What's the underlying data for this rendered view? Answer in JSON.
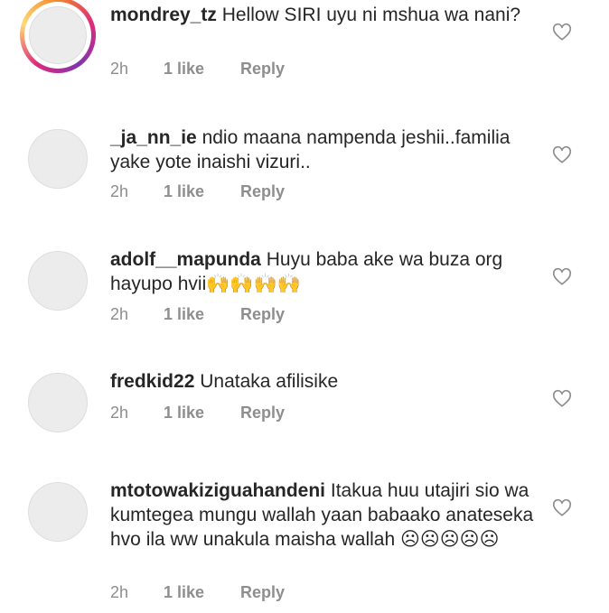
{
  "comments": [
    {
      "username": "mondrey_tz",
      "text": "Hellow SIRI  uyu ni mshua wa nani?",
      "time": "2h",
      "likes": "1 like",
      "reply": "Reply",
      "has_story": true,
      "avatar_icon": "avatar-placeholder",
      "like_icon": "heart-outline-icon"
    },
    {
      "username": "_ja_nn_ie",
      "text": "ndio maana nampenda jeshii..familia yake yote inaishi vizuri..",
      "time": "2h",
      "likes": "1 like",
      "reply": "Reply",
      "has_story": false,
      "avatar_icon": "avatar-placeholder",
      "like_icon": "heart-outline-icon"
    },
    {
      "username": "adolf__mapunda",
      "text": "Huyu baba ake wa buza org hayupo hvii🙌🙌🙌🙌",
      "time": "2h",
      "likes": "1 like",
      "reply": "Reply",
      "has_story": false,
      "avatar_icon": "avatar-placeholder",
      "like_icon": "heart-outline-icon"
    },
    {
      "username": "fredkid22",
      "text": "Unataka afilisike",
      "time": "2h",
      "likes": "1 like",
      "reply": "Reply",
      "has_story": false,
      "avatar_icon": "avatar-placeholder",
      "like_icon": "heart-outline-icon"
    },
    {
      "username": "mtotowakiziguahandeni",
      "text": "Itakua huu utajiri sio wa kumtegea mungu wallah yaan babaako anateseka hvo ila ww unakula maisha wallah ☹☹☹☹☹",
      "time": "2h",
      "likes": "1 like",
      "reply": "Reply",
      "has_story": false,
      "avatar_icon": "avatar-placeholder",
      "like_icon": "heart-outline-icon"
    }
  ],
  "colors": {
    "text": "#262626",
    "meta": "#8e8e8e",
    "avatar_bg": "#ececec",
    "story_ring": [
      "#f58529",
      "#dd2a7b",
      "#8134af"
    ]
  }
}
